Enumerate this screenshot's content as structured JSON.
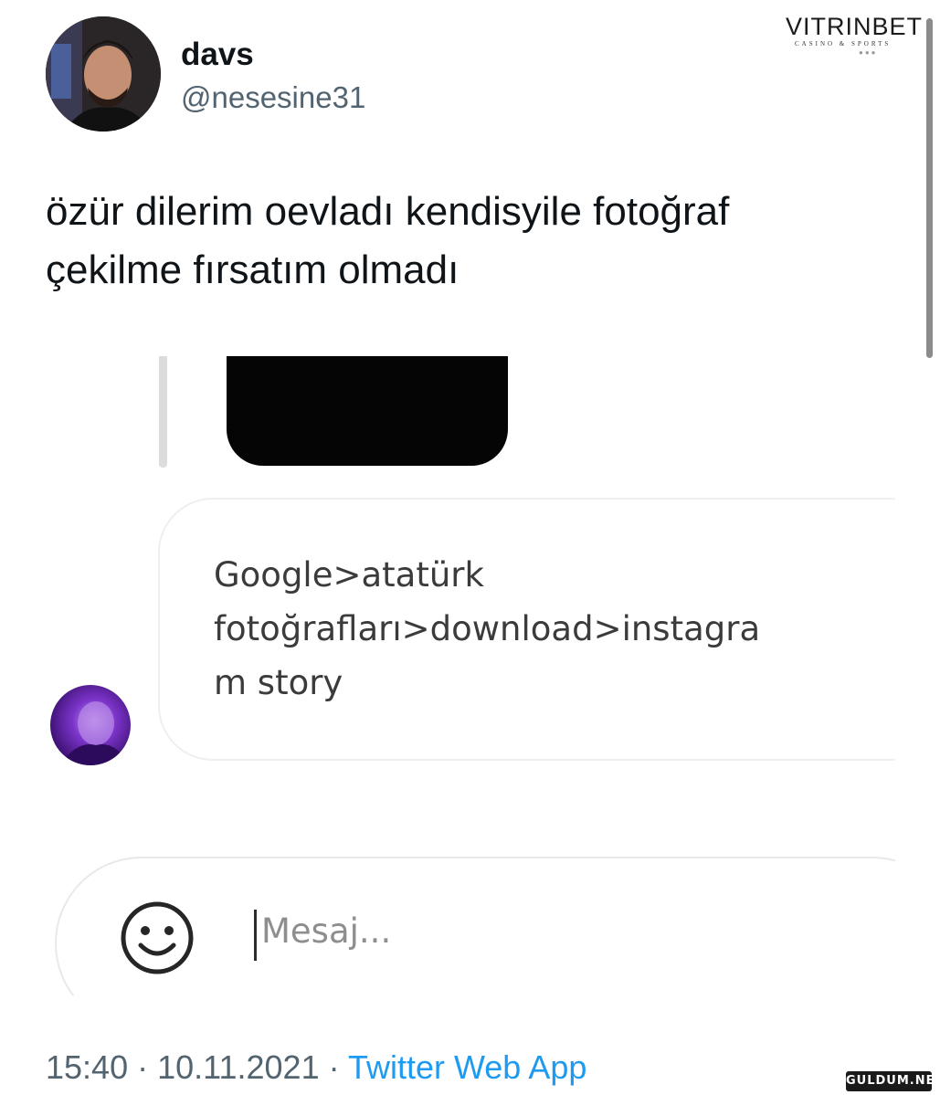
{
  "tweet": {
    "display_name": "davs",
    "handle": "@nesesine31",
    "text_line_1": "özür dilerim oevladı kendisyile fotoğraf",
    "text_line_2": "çekilme fırsatım olmadı",
    "timestamp": "15:40 · 10.11.2021 · ",
    "source": "Twitter Web App"
  },
  "screenshot": {
    "message_text": "Google>atatürk\nfotoğrafları>download>instagra\nm story",
    "input_placeholder": "Mesaj...",
    "emoji_icon": "smiley-face-icon"
  },
  "watermarks": {
    "top_right_logo": "VITRINBET",
    "top_right_logo_sub": "CASINO & SPORTS",
    "bottom_right": "GULDUM.NET"
  },
  "colors": {
    "link_blue": "#1d9bf0",
    "secondary_text": "#536471",
    "primary_text": "#0f1419"
  }
}
